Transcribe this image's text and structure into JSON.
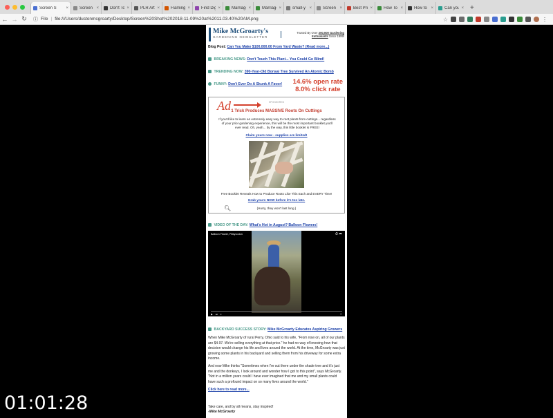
{
  "browser": {
    "tabs": [
      {
        "label": "Screen S",
        "active": true
      },
      {
        "label": "Screen S"
      },
      {
        "label": "Don't To"
      },
      {
        "label": "PLR Arti"
      },
      {
        "label": "Flaming"
      },
      {
        "label": "Find Dig"
      },
      {
        "label": "Marriage"
      },
      {
        "label": "Marriage"
      },
      {
        "label": "small-y"
      },
      {
        "label": "Screen S"
      },
      {
        "label": "Best Pro"
      },
      {
        "label": "How To"
      },
      {
        "label": "How to"
      },
      {
        "label": "Can you"
      }
    ],
    "new_tab": "+",
    "url_prefix": "File",
    "url": "file:///Users/dustonmcgroarty/Desktop/Screen%20Shot%202018-11-09%20at%2011.03.40%20AM.png",
    "colors": {
      "close": "#fc5f57",
      "minimize": "#fdbc2e",
      "maximize": "#28c840"
    }
  },
  "newsletter": {
    "logo_line1": "Mike McGroarty's",
    "logo_line2": "GARDENING NEWSLETTER",
    "trusted_prefix": "Trusted By Over",
    "trusted_count": "200,000 Gardening",
    "trusted_link": "Enthusiasts",
    "trusted_suffix": "Since 1999!",
    "blog_label": "Blog Post:",
    "blog_link": "Can You Make $100,000.00 From Yard Waste? (Read more...)",
    "breaking_label": "BREAKING NEWS:",
    "breaking_link": "Don't Touch This Plant... You Could Go Blind!",
    "trending_label": "TRENDING NOW:",
    "trending_link": "390-Year-Old Bonsai Tree Survived An Atomic Bomb",
    "funny_label": "FUNNY:",
    "funny_link": "Don't Ever Do A Skunk A Favor!",
    "open_rate": "14.6% open rate",
    "click_rate": "8.0% click rate",
    "ad": {
      "annotation": "Ad",
      "sponsored": "SPONSORED",
      "headline": "1 Trick Produces MASSIVE Roots On Cuttings",
      "body": "If you'd like to learn an extremely easy way to root plants from cuttings... regardless of your prior gardening experience, this will be the most important booklet you'll ever read. Oh, yeah... by the way, this little booklet is FREE!",
      "claim": "Claim yours now - supplies are limited!",
      "free_line": "Free Booklet Reveals How to Produce Roots Like This Each and EVERY Time!",
      "grab": "Grab yours NOW before it's too late.",
      "hurry": "(Hurry, they won't last long.)"
    },
    "video_label": "VIDEO OF THE DAY:",
    "video_link": "What's Hot in August? Balloon Flowers!",
    "video_title": "Balloon Flower, Platycodon",
    "success_label": "BACKYARD SUCCESS STORY:",
    "success_link": "Mike McGroarty Educates Aspiring Growers",
    "para1": "When Mike McGroarty of rural Perry, Ohio said to his wife, \"From now on, all of our plants are $4.97. We're selling everything at that price.\" he had no way of knowing how that decision would change his life and lives around the world. At the time, McGroarty was just growing some plants in his backyard and selling them from his driveway for some extra income.",
    "para2": "And now Mike thinks \"Sometimes when I'm out there under the shade tree and it's just me and the donkeys, I look around and wonder how I got to this point\", says McGroarty. \"Not in a million years could I have ever imagined that me and my small plants could have such a profound impact on so many lives around the world.\"",
    "read_more": "Click here to read more...",
    "signoff1": "Take care, and by all means, stay inspired!",
    "signoff2": "-Mike McGroarty"
  },
  "overlay": {
    "timer": "01:01:28"
  }
}
